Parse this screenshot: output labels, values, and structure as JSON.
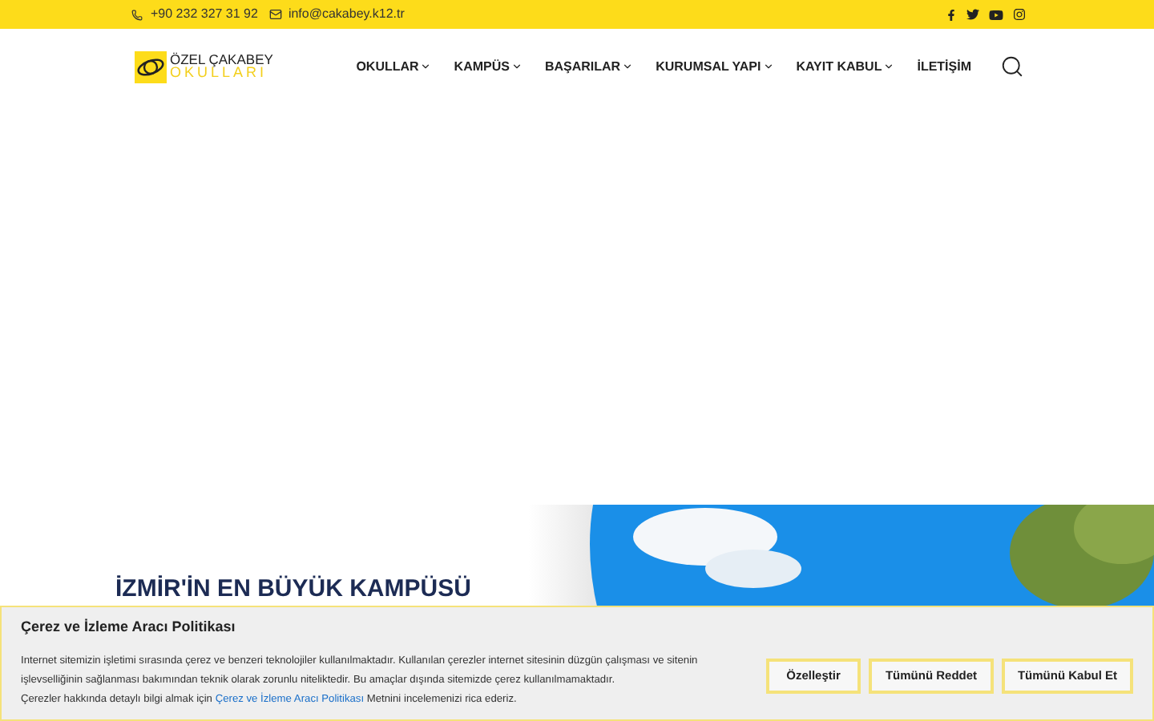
{
  "top_bar": {
    "phone": "+90 232 327 31 92",
    "email": "info@cakabey.k12.tr"
  },
  "logo": {
    "line1": "ÖZEL ÇAKABEY",
    "line2": "OKULLARI"
  },
  "nav": [
    {
      "label": "OKULLAR",
      "dropdown": true
    },
    {
      "label": "KAMPÜS",
      "dropdown": true
    },
    {
      "label": "BAŞARILAR",
      "dropdown": true
    },
    {
      "label": "KURUMSAL YAPI",
      "dropdown": true
    },
    {
      "label": "KAYIT KABUL",
      "dropdown": true
    },
    {
      "label": "İLETİŞİM",
      "dropdown": false
    }
  ],
  "hero": {
    "heading": "İZMİR'İN EN BÜYÜK KAMPÜSÜ"
  },
  "cookie_banner": {
    "title": "Çerez ve İzleme Aracı Politikası",
    "text": "Internet sitemizin işletimi sırasında çerez ve benzeri teknolojiler kullanılmaktadır. Kullanılan çerezler internet sitesinin düzgün çalışması ve sitenin işlevselliğinin sağlanması bakımından teknik olarak zorunlu niteliktedir. Bu amaçlar dışında sitemizde çerez kullanılmamaktadır.",
    "more_prefix": "Çerezler hakkında detaylı bilgi almak için",
    "link": "Çerez ve İzleme Aracı Politikası",
    "more_suffix": "Metnini incelemenizi rica ederiz.",
    "buttons": [
      "Özelleştir",
      "Tümünü Reddet",
      "Tümünü Kabul Et"
    ]
  }
}
